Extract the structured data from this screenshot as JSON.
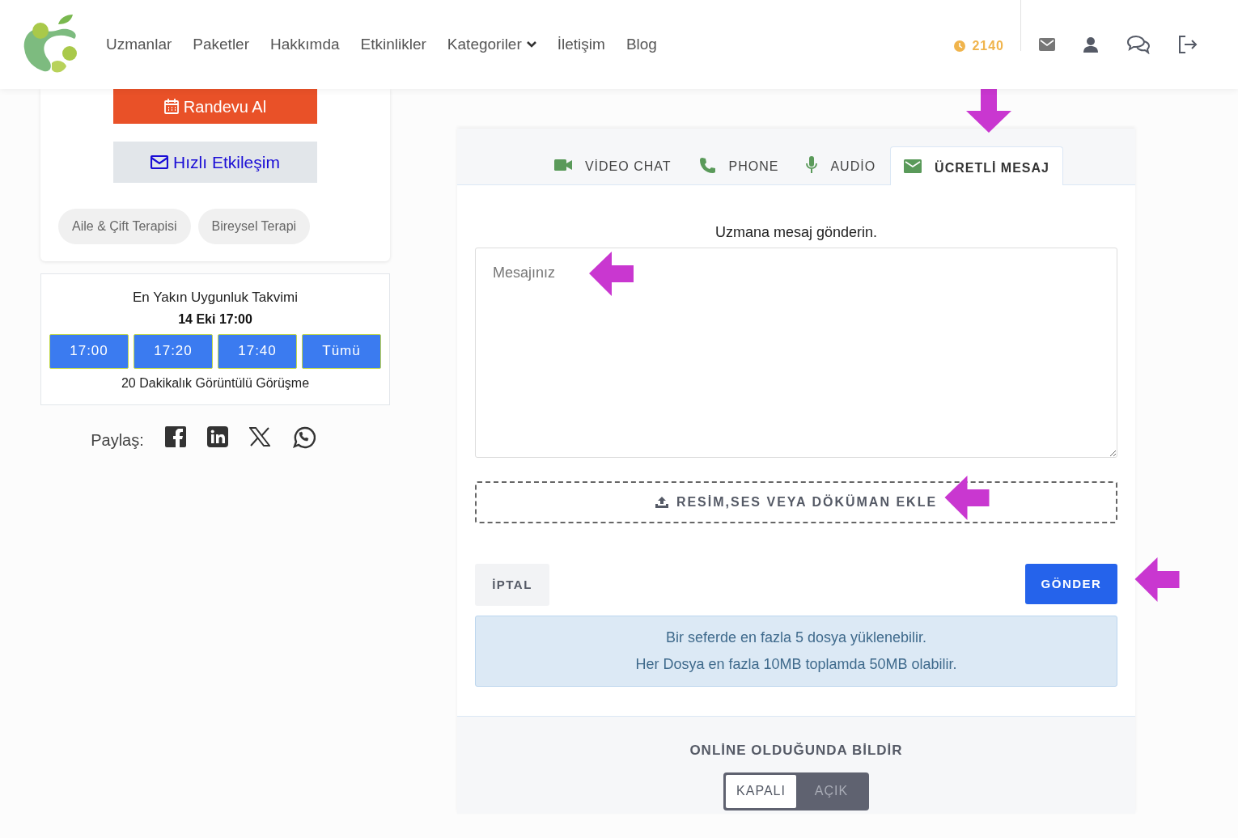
{
  "nav": {
    "items": [
      {
        "label": "Uzmanlar",
        "kind": "link"
      },
      {
        "label": "Paketler",
        "kind": "link"
      },
      {
        "label": "Hakkımda",
        "kind": "link"
      },
      {
        "label": "Etkinlikler",
        "kind": "link"
      },
      {
        "label": "Kategoriler",
        "kind": "dropdown"
      },
      {
        "label": "İletişim",
        "kind": "link"
      },
      {
        "label": "Blog",
        "kind": "link"
      }
    ],
    "credits": "2140"
  },
  "profile_card": {
    "appointment_button": "Randevu Al",
    "quick_button": "Hızlı Etkileşim",
    "tags": [
      "Aile & Çift Terapisi",
      "Bireysel Terapi"
    ]
  },
  "availability": {
    "title": "En Yakın Uygunluk Takvimi",
    "next": "14 Eki 17:00",
    "slots": [
      "17:00",
      "17:20",
      "17:40",
      "Tümü"
    ],
    "note": "20 Dakikalık Görüntülü Görüşme"
  },
  "share": {
    "label": "Paylaş:"
  },
  "contact": {
    "tabs": [
      {
        "label": "VİDEO CHAT",
        "kind": "video",
        "selected": false
      },
      {
        "label": "PHONE",
        "kind": "phone",
        "selected": false
      },
      {
        "label": "AUDİO",
        "kind": "mic",
        "selected": false
      },
      {
        "label": "ÜCRETLİ MESAJ",
        "kind": "mail",
        "selected": true
      }
    ],
    "prompt": "Uzmana mesaj gönderin.",
    "message": {
      "placeholder": "Mesajınız"
    },
    "upload": "RESİM,SES VEYA DÖKÜMAN EKLE",
    "cancel": "İPTAL",
    "send": "GÖNDER",
    "info": [
      "Bir seferde en fazla 5 dosya yüklenebilir.",
      "Her Dosya en fazla 10MB toplamda 50MB olabilir."
    ]
  },
  "notify": {
    "title": "ONLİNE OLDUĞUNDA BİLDİR",
    "options": [
      {
        "label": "KAPALI",
        "selected": true
      },
      {
        "label": "AÇIK",
        "selected": false
      }
    ]
  }
}
